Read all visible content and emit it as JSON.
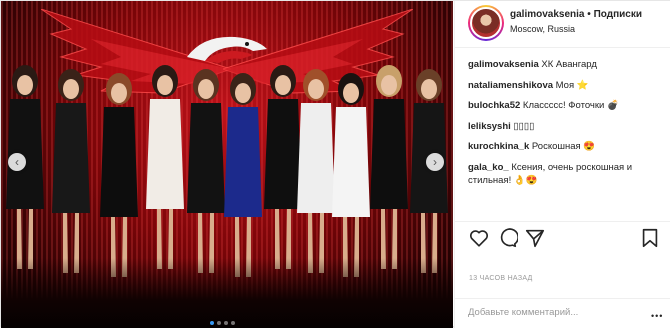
{
  "post": {
    "username": "galimovaksenia",
    "separator": "•",
    "follow_label": "Подписки",
    "location": "Moscow, Russia"
  },
  "comments": [
    {
      "user": "galimovaksenia",
      "text": "ХК Авангард"
    },
    {
      "user": "nataliamenshikova",
      "text": "Моя ⭐"
    },
    {
      "user": "bulochka52",
      "text": "Классссс! Фоточки 💣"
    },
    {
      "user": "leliksyshi",
      "text": "▯▯▯▯"
    },
    {
      "user": "kurochkina_k",
      "text": "Роскошная 😍"
    },
    {
      "user": "gala_ko_",
      "text": "Ксения, очень роскошная и стильная! 👌😍"
    }
  ],
  "timestamp": "13 часов назад",
  "add_comment_placeholder": "Добавьте комментарий...",
  "more_label": "•••",
  "carousel": {
    "prev_glyph": "‹",
    "next_glyph": "›",
    "count": 4,
    "active_index": 0
  },
  "icons": {
    "like": "heart-icon",
    "comment": "comment-icon",
    "share": "share-icon",
    "save": "bookmark-icon"
  },
  "colors": {
    "accent": "#3897f0",
    "backdrop": "#b3121a"
  }
}
